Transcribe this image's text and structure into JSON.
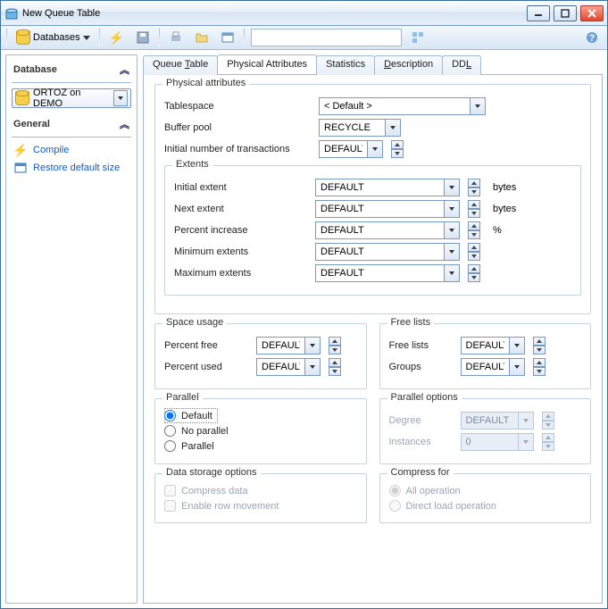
{
  "window": {
    "title": "New Queue Table"
  },
  "toolbar": {
    "databases_label": "Databases"
  },
  "sidebar": {
    "database_hdr": "Database",
    "db_value": "ORTOZ on DEMO",
    "general_hdr": "General",
    "compile": "Compile",
    "restore": "Restore default size"
  },
  "tabs": {
    "queue_table": "Queue Table",
    "physical": "Physical Attributes",
    "statistics": "Statistics",
    "description": "Description",
    "ddl": "DDL"
  },
  "phys": {
    "title": "Physical attributes",
    "tablespace_lbl": "Tablespace",
    "tablespace_val": "< Default >",
    "bufferpool_lbl": "Buffer pool",
    "bufferpool_val": "RECYCLE",
    "initrans_lbl": "Initial number of transactions",
    "initrans_val": "DEFAULT"
  },
  "extents": {
    "title": "Extents",
    "initial_lbl": "Initial extent",
    "initial_val": "DEFAULT",
    "next_lbl": "Next extent",
    "next_val": "DEFAULT",
    "pct_lbl": "Percent increase",
    "pct_val": "DEFAULT",
    "min_lbl": "Minimum extents",
    "min_val": "DEFAULT",
    "max_lbl": "Maximum extents",
    "max_val": "DEFAULT",
    "bytes": "bytes",
    "percent": "%"
  },
  "space": {
    "title": "Space usage",
    "pfree_lbl": "Percent free",
    "pfree_val": "DEFAULT",
    "pused_lbl": "Percent used",
    "pused_val": "DEFAULT"
  },
  "freelists": {
    "title": "Free lists",
    "fl_lbl": "Free lists",
    "fl_val": "DEFAULT",
    "grp_lbl": "Groups",
    "grp_val": "DEFAULT"
  },
  "parallel": {
    "title": "Parallel",
    "default": "Default",
    "noparallel": "No parallel",
    "parallel": "Parallel",
    "opts_title": "Parallel options",
    "degree_lbl": "Degree",
    "degree_val": "DEFAULT",
    "inst_lbl": "Instances",
    "inst_val": "0"
  },
  "storage": {
    "title": "Data storage options",
    "compress": "Compress data",
    "rowmove": "Enable row movement",
    "compfor_title": "Compress for",
    "allop": "All operation",
    "direct": "Direct load operation"
  }
}
